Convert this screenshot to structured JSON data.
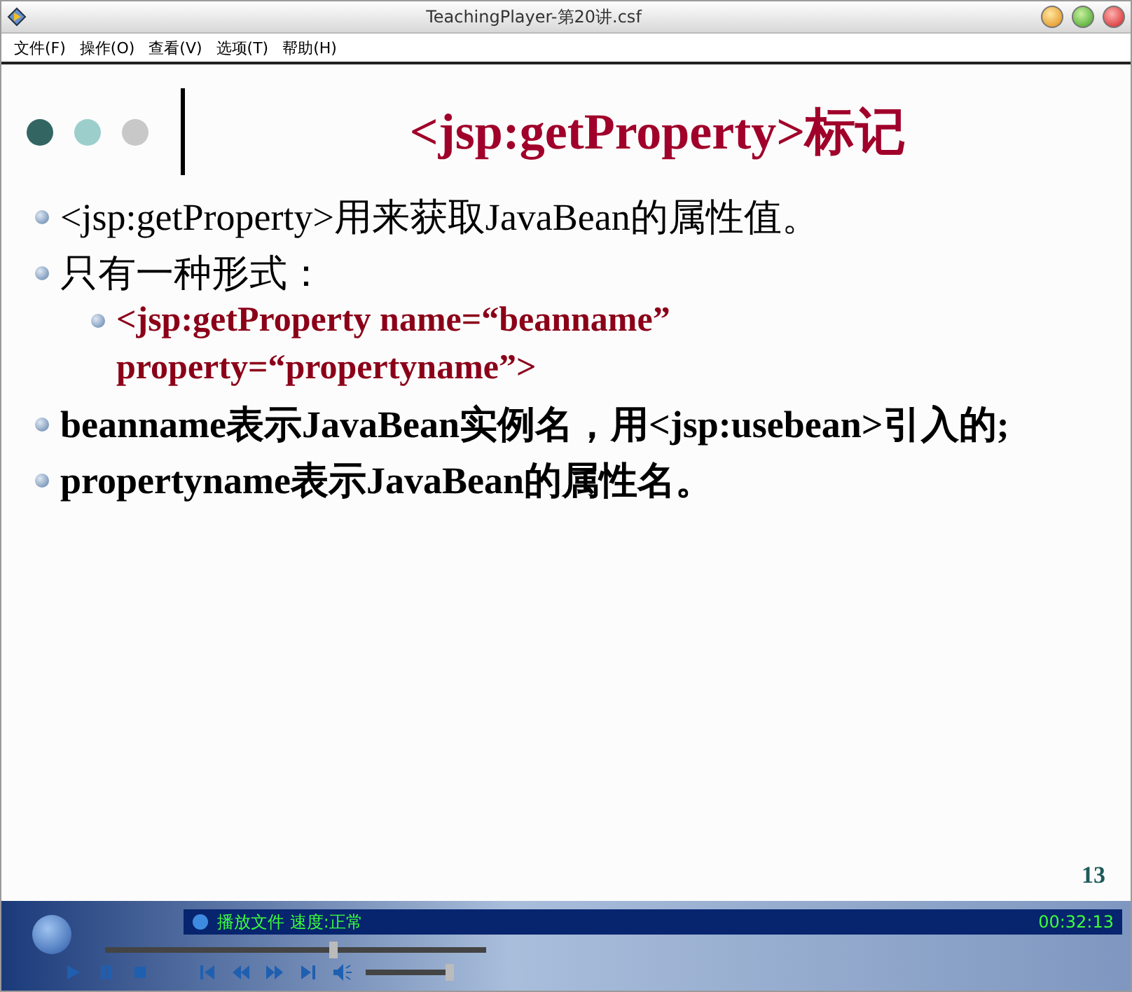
{
  "window": {
    "title": "TeachingPlayer-第20讲.csf"
  },
  "menu": [
    "文件(F)",
    "操作(O)",
    "查看(V)",
    "选项(T)",
    "帮助(H)"
  ],
  "slide": {
    "title": "<jsp:getProperty>标记",
    "page_number": "13",
    "bullets": [
      {
        "text": "<jsp:getProperty>用来获取JavaBean的属性值。",
        "bold": false
      },
      {
        "text": "只有一种形式：",
        "bold": false,
        "children": [
          {
            "text": "<jsp:getProperty  name=“beanname” property=“propertyname”>",
            "bold": true
          }
        ]
      },
      {
        "text": "beanname表示JavaBean实例名，用<jsp:usebean>引入的;",
        "bold": true
      },
      {
        "text": "propertyname表示JavaBean的属性名。",
        "bold": true
      }
    ]
  },
  "player": {
    "status": "播放文件 速度:正常",
    "time": "00:32:13",
    "progress": {
      "level": 0.6
    },
    "volume": {
      "level": 1.0
    }
  }
}
